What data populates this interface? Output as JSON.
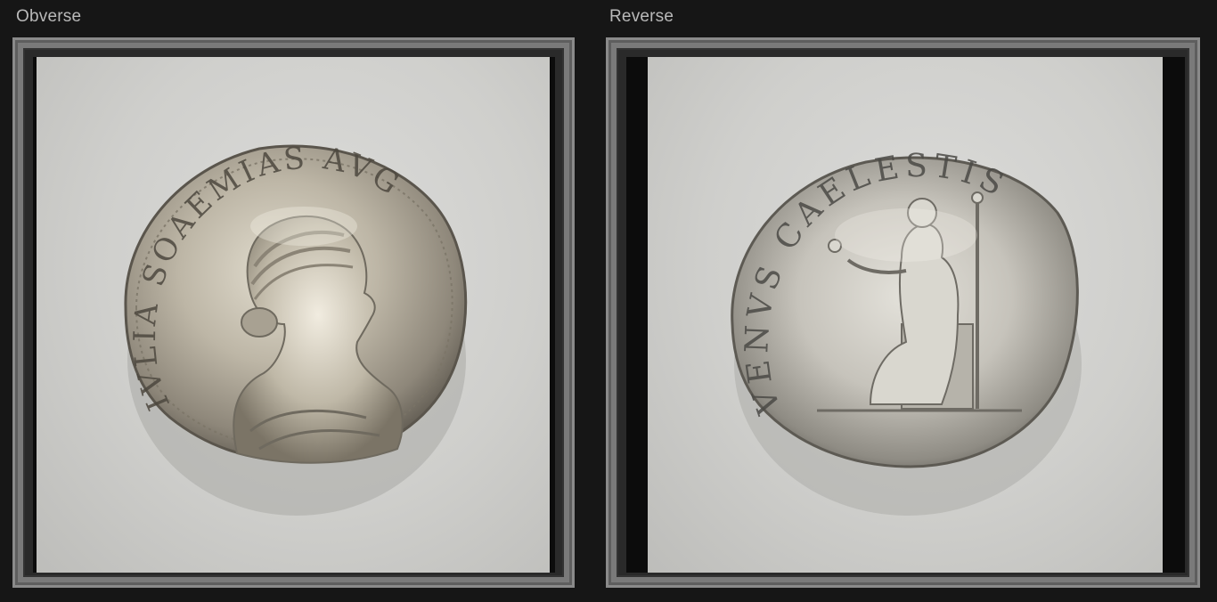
{
  "panels": {
    "obverse": {
      "label": "Obverse",
      "legend": "IVLIA SOAEMIAS AVG"
    },
    "reverse": {
      "label": "Reverse",
      "legend": "VENVS CAELESTIS"
    }
  },
  "colors": {
    "background": "#161616",
    "frame": "#8a8a8a",
    "paper": "#d2d2cf",
    "silver_light": "#d9d6cc",
    "silver_dark": "#6f6a60"
  }
}
